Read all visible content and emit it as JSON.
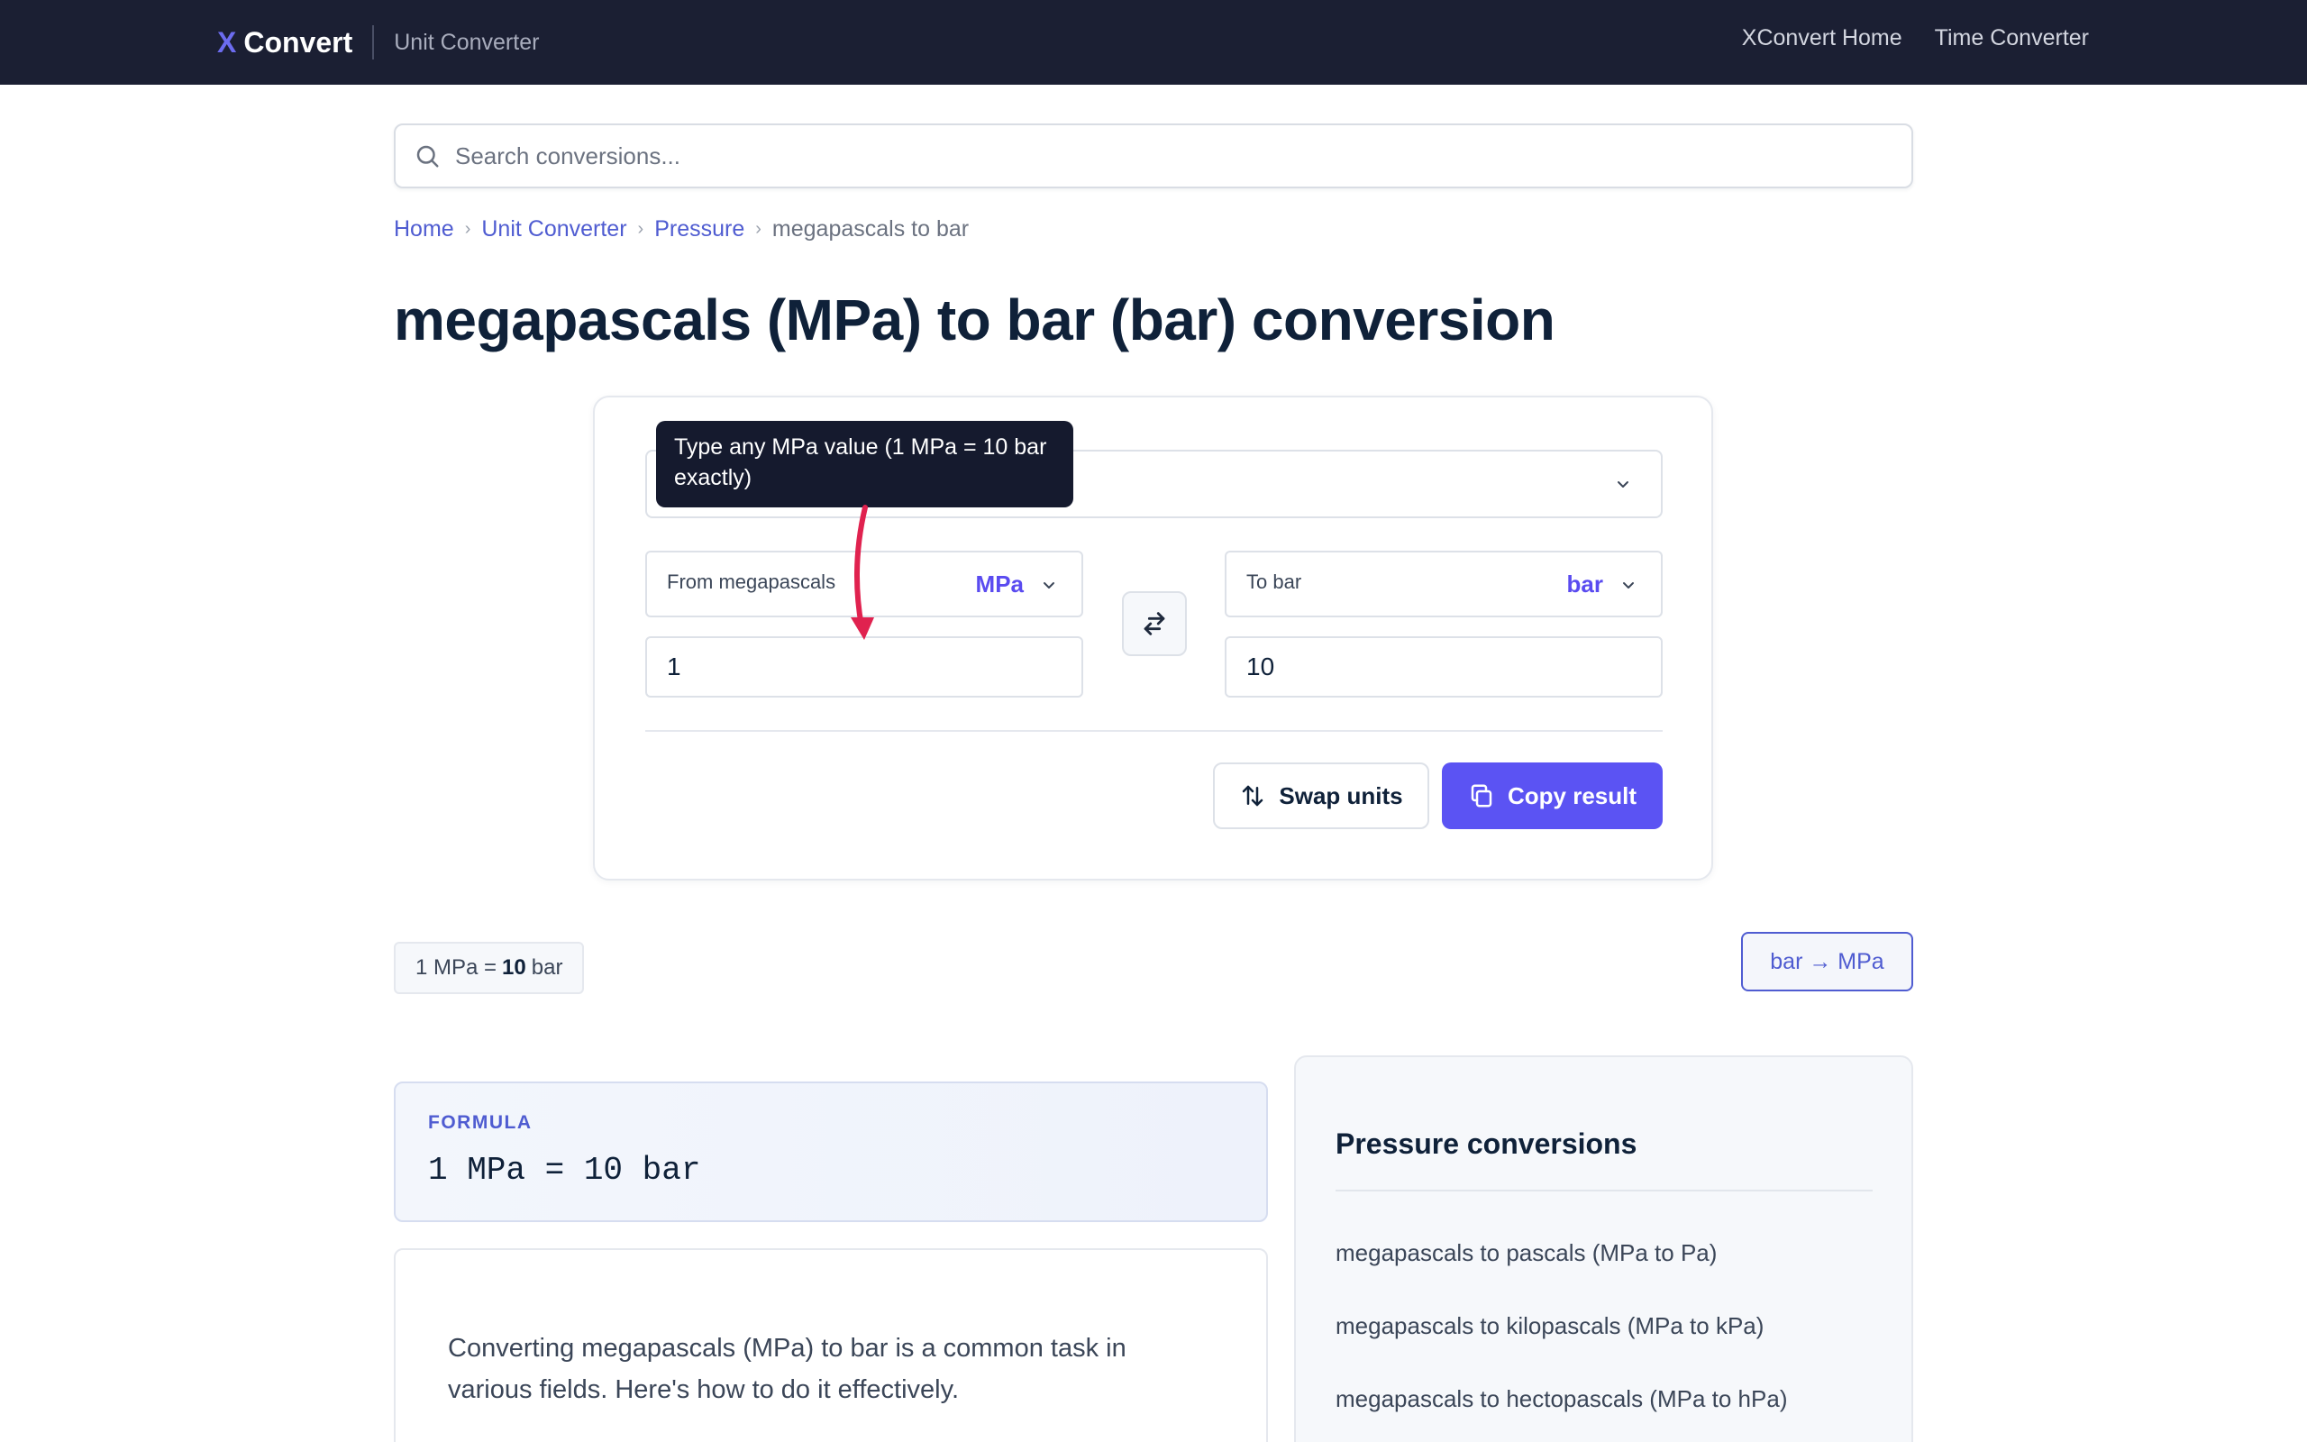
{
  "header": {
    "brand_x": "X",
    "brand_name": "Convert",
    "section": "Unit Converter",
    "links": [
      "XConvert Home",
      "Time Converter"
    ]
  },
  "search": {
    "placeholder": "Search conversions...",
    "value": ""
  },
  "breadcrumb": {
    "items": [
      "Home",
      "Unit Converter",
      "Pressure"
    ],
    "current": "megapascals to bar"
  },
  "page": {
    "title": "megapascals (MPa) to bar (bar) conversion"
  },
  "converter": {
    "tooltip": "Type any MPa value (1 MPa = 10 bar exactly)",
    "from": {
      "label": "From megapascals",
      "unit": "MPa",
      "value": "1"
    },
    "to": {
      "label": "To bar",
      "unit": "bar",
      "value": "10"
    },
    "swap_label": "Swap units",
    "copy_label": "Copy result"
  },
  "ratio": {
    "prefix": "1 MPa =",
    "value": "10",
    "suffix": "bar"
  },
  "reverse_link": "bar → MPa",
  "formula": {
    "caption": "FORMULA",
    "expression": "1 MPa = 10 bar"
  },
  "article": {
    "intro": "Converting megapascals (MPa) to bar is a common task in various fields. Here's how to do it effectively."
  },
  "sidebar": {
    "title": "Pressure conversions",
    "links": [
      "megapascals to pascals (MPa to Pa)",
      "megapascals to kilopascals (MPa to kPa)",
      "megapascals to hectopascals (MPa to hPa)"
    ]
  },
  "colors": {
    "nav_bg": "#1b1f33",
    "accent": "#5b53f3",
    "link": "#4f5cd1",
    "annotation_arrow": "#e0224f"
  }
}
